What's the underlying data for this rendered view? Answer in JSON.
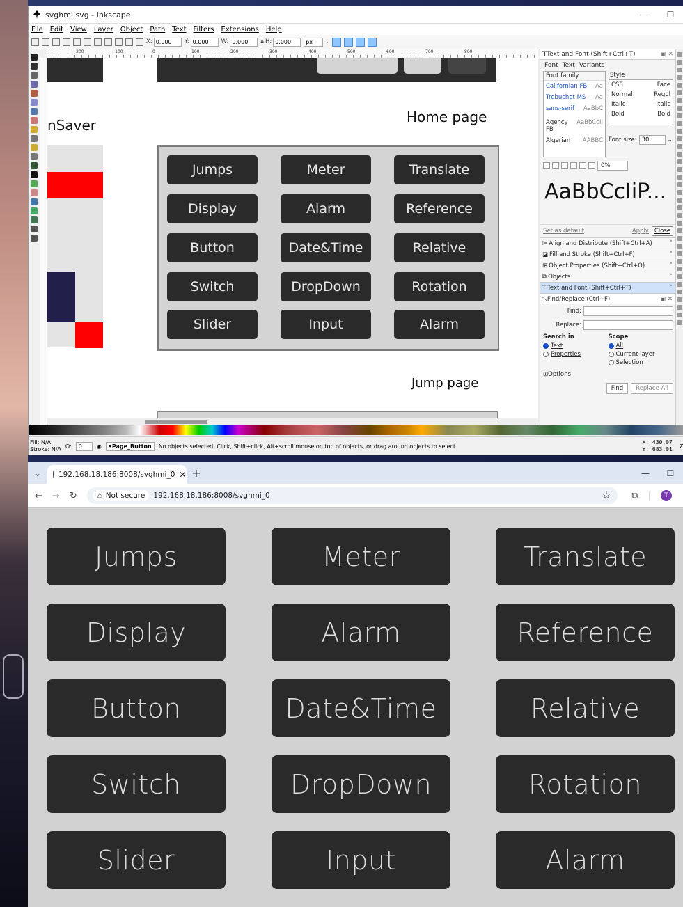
{
  "inkscape": {
    "window_title": "svghmi.svg - Inkscape",
    "menu": [
      "File",
      "Edit",
      "View",
      "Layer",
      "Object",
      "Path",
      "Text",
      "Filters",
      "Extensions",
      "Help"
    ],
    "toolbar": {
      "x_label": "X:",
      "x_value": "0.000",
      "y_label": "Y:",
      "y_value": "0.000",
      "w_label": "W:",
      "w_value": "0.000",
      "h_label": "H:",
      "h_value": "0.000",
      "unit": "px"
    },
    "ruler_labels": [
      "-200",
      "-100",
      "0",
      "100",
      "200",
      "300",
      "400",
      "500",
      "600",
      "700",
      "800"
    ],
    "canvas": {
      "side_text": "nSaver",
      "home_label": "Home page",
      "jump_label": "Jump page",
      "buttons": [
        [
          "Jumps",
          "Meter",
          "Translate"
        ],
        [
          "Display",
          "Alarm",
          "Reference"
        ],
        [
          "Button",
          "Date&Time",
          "Relative"
        ],
        [
          "Switch",
          "DropDown",
          "Rotation"
        ],
        [
          "Slider",
          "Input",
          "Alarm"
        ]
      ]
    },
    "text_font_dialog": {
      "title": "Text and Font (Shift+Ctrl+T)",
      "tabs": [
        "Font",
        "Text",
        "Variants"
      ],
      "font_family_header": "Font family",
      "families": [
        {
          "name": "Californian FB",
          "sample": "Aa"
        },
        {
          "name": "Trebuchet MS",
          "sample": "Aa"
        },
        {
          "name": "sans-serif",
          "sample": "AaBbC"
        },
        {
          "name": "Agency FB",
          "sample": "AaBbCcII"
        },
        {
          "name": "Algerian",
          "sample": "AABBC"
        }
      ],
      "style_header": "Style",
      "styles": [
        [
          "CSS",
          "Face"
        ],
        [
          "Normal",
          "Regul"
        ],
        [
          "Italic",
          "Italic"
        ],
        [
          "Bold",
          "Bold"
        ]
      ],
      "font_size_label": "Font size:",
      "font_size_value": "30",
      "spacing_value": "0%",
      "preview": "AaBbCcIiP...",
      "set_default": "Set as default",
      "apply": "Apply",
      "close": "Close"
    },
    "panels": [
      "Align and Distribute (Shift+Ctrl+A)",
      "Fill and Stroke (Shift+Ctrl+F)",
      "Object Properties (Shift+Ctrl+O)",
      "Objects",
      "Text and Font (Shift+Ctrl+T)"
    ],
    "find_replace": {
      "title": "Find/Replace (Ctrl+F)",
      "find_label": "Find:",
      "replace_label": "Replace:",
      "search_in": "Search in",
      "search_text": "Text",
      "search_props": "Properties",
      "scope": "Scope",
      "scope_all": "All",
      "scope_layer": "Current layer",
      "scope_selection": "Selection",
      "options": "Options",
      "find_button": "Find",
      "replace_all": "Replace All"
    },
    "status": {
      "fill_label": "Fill:",
      "fill_value": "N/A",
      "stroke_label": "Stroke:",
      "stroke_value": "N/A",
      "opacity_label": "O:",
      "opacity_value": "0",
      "layer": "•Page_Button",
      "message": "No objects selected. Click, Shift+click, Alt+scroll mouse on top of objects, or drag around objects to select.",
      "x_coord": "X: 430.07",
      "y_coord": "Y: 683.01",
      "zoom_label": "Z:"
    }
  },
  "browser": {
    "tab_title": "192.168.18.186:8008/svghmi_0",
    "security_label": "Not secure",
    "url": "192.168.18.186:8008/svghmi_0",
    "avatar_letter": "T",
    "buttons": [
      [
        "Jumps",
        "Meter",
        "Translate"
      ],
      [
        "Display",
        "Alarm",
        "Reference"
      ],
      [
        "Button",
        "Date&Time",
        "Relative"
      ],
      [
        "Switch",
        "DropDown",
        "Rotation"
      ],
      [
        "Slider",
        "Input",
        "Alarm"
      ]
    ]
  }
}
